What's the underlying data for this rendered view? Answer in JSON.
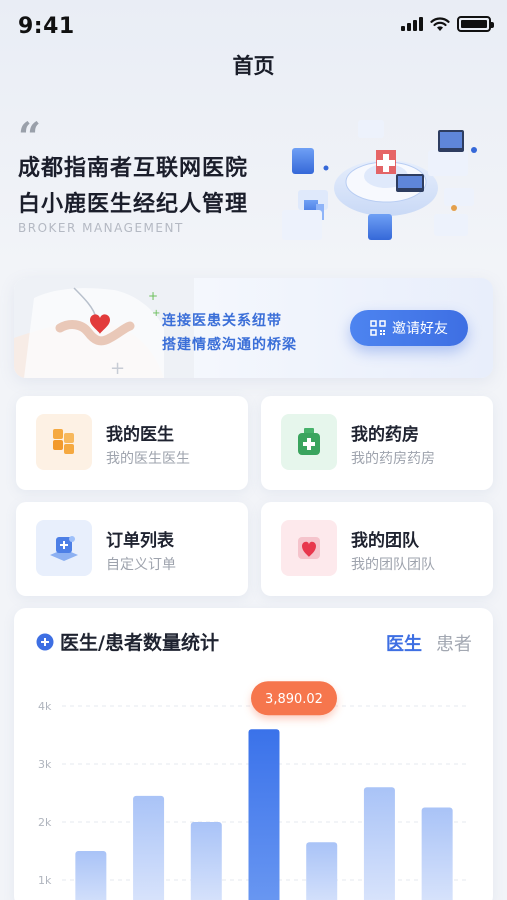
{
  "status_bar": {
    "time": "9:41"
  },
  "header": {
    "title": "首页"
  },
  "hero": {
    "quote": "“",
    "line1": "成都指南者互联网医院",
    "line2": "白小鹿医生经纪人管理",
    "subtitle": "BROKER MANAGEMENT"
  },
  "banner": {
    "line1": "连接医患关系纽带",
    "line2": "搭建情感沟通的桥梁",
    "button_label": "邀请好友"
  },
  "cards": [
    {
      "title": "我的医生",
      "subtitle": "我的医生医生",
      "icon": "blocks-icon",
      "icon_bg": "#fdf1e4"
    },
    {
      "title": "我的药房",
      "subtitle": "我的药房药房",
      "icon": "medicine-box-icon",
      "icon_bg": "#e6f6ec"
    },
    {
      "title": "订单列表",
      "subtitle": "自定义订单",
      "icon": "order-icon",
      "icon_bg": "#e8effc"
    },
    {
      "title": "我的团队",
      "subtitle": "我的团队团队",
      "icon": "heart-team-icon",
      "icon_bg": "#fde9ec"
    }
  ],
  "stats": {
    "title": "医生/患者数量统计",
    "tabs": [
      "医生",
      "患者"
    ],
    "active_tab": "医生"
  },
  "colors": {
    "accent": "#3e6fe3",
    "tooltip": "#f6764e"
  },
  "chart_data": {
    "type": "bar",
    "y_ticks": [
      "4k",
      "3k",
      "2k",
      "1k"
    ],
    "ylim": [
      0,
      4000
    ],
    "values": [
      1500,
      2450,
      2000,
      3600,
      1650,
      2600,
      2250
    ],
    "highlight_index": 3,
    "tooltip": "3,890.02",
    "grid": true
  }
}
